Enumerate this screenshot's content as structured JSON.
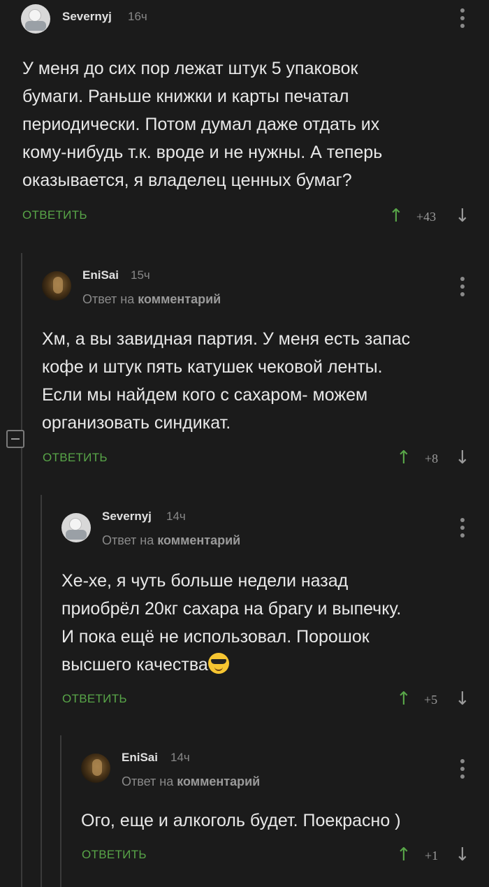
{
  "comments": [
    {
      "username": "Severnyj",
      "time": "16ч",
      "text_lines": [
        "У меня до сих пор лежат штук 5 упаковок",
        "бумаги. Раньше книжки и карты печатал",
        "периодически. Потом думал даже отдать их",
        "кому-нибудь т.к. вроде и не нужны. А теперь",
        "оказывается, я владелец ценных бумаг?"
      ],
      "reply_label": "ОТВЕТИТЬ",
      "rating": "+43"
    },
    {
      "username": "EniSai",
      "time": "15ч",
      "reply_prefix": "Ответ на",
      "reply_link": "комментарий",
      "text_lines": [
        "Хм, а вы завидная партия. У меня есть запас",
        "кофе и штук пять катушек чековой ленты.",
        "Если мы найдем кого с сахаром- можем",
        "организовать синдикат."
      ],
      "reply_label": "ОТВЕТИТЬ",
      "rating": "+8"
    },
    {
      "username": "Severnyj",
      "time": "14ч",
      "reply_prefix": "Ответ на",
      "reply_link": "комментарий",
      "text_lines": [
        "Хе-хе, я чуть больше недели назад",
        "приобрёл 20кг сахара на брагу и выпечку.",
        "И пока ещё не использовал. Порошок",
        "высшего качества"
      ],
      "emoji": "sunglasses-emoji",
      "reply_label": "ОТВЕТИТЬ",
      "rating": "+5"
    },
    {
      "username": "EniSai",
      "time": "14ч",
      "reply_prefix": "Ответ на",
      "reply_link": "комментарий",
      "text_lines": [
        "Ого, еще и алкоголь будет. Поекрасно )"
      ],
      "reply_label": "ОТВЕТИТЬ",
      "rating": "+1"
    }
  ],
  "icons": {
    "upvote": "↑",
    "downvote": "↓"
  },
  "colors": {
    "background": "#1b1b1b",
    "accent_green": "#58a548",
    "text": "#e8e8e8",
    "muted": "#8a8a8a"
  }
}
